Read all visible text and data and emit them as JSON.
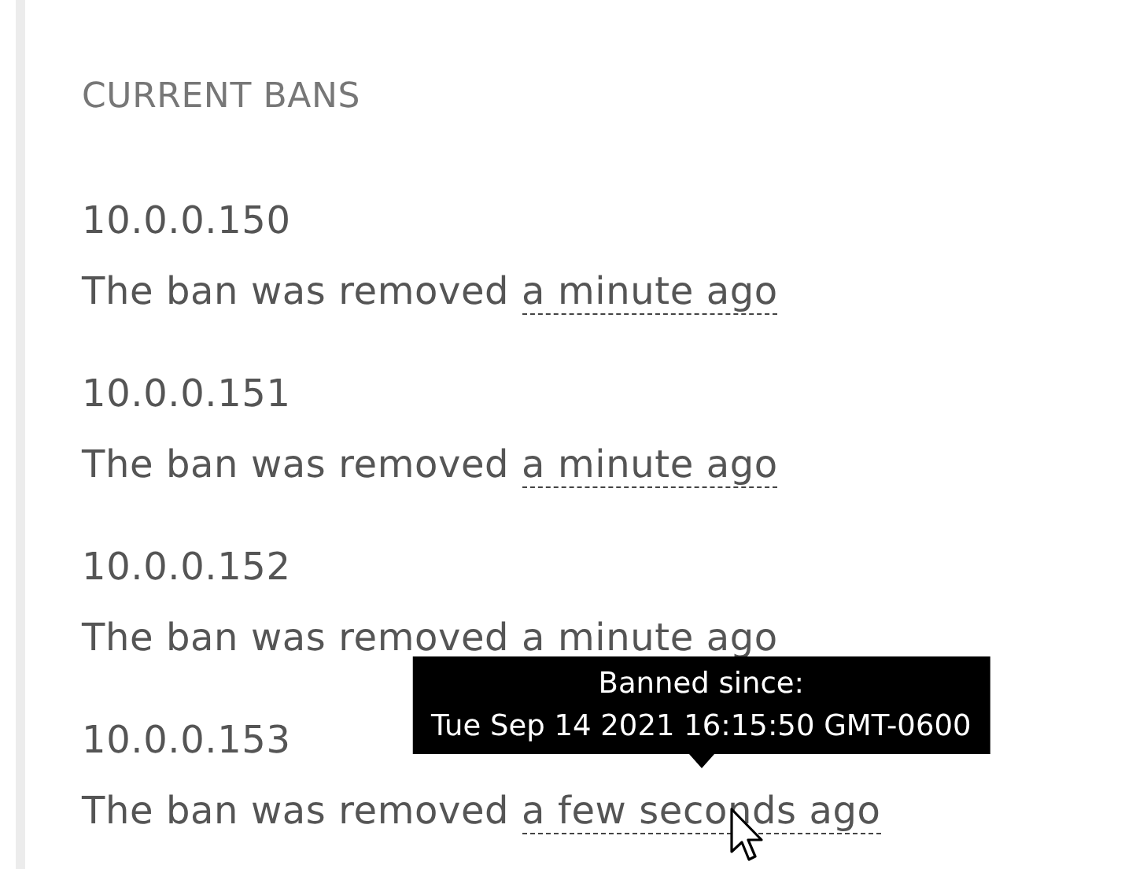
{
  "heading": "CURRENT BANS",
  "bans": [
    {
      "ip": "10.0.0.150",
      "text": "The ban was removed",
      "time": "a minute ago"
    },
    {
      "ip": "10.0.0.151",
      "text": "The ban was removed",
      "time": "a minute ago"
    },
    {
      "ip": "10.0.0.152",
      "text": "The ban was removed",
      "time": "a minute ago"
    },
    {
      "ip": "10.0.0.153",
      "text": "The ban was removed",
      "time": "a few seconds ago",
      "tooltip": [
        "Banned since:",
        "Tue Sep 14 2021 16:15:50 GMT-0600"
      ]
    }
  ]
}
